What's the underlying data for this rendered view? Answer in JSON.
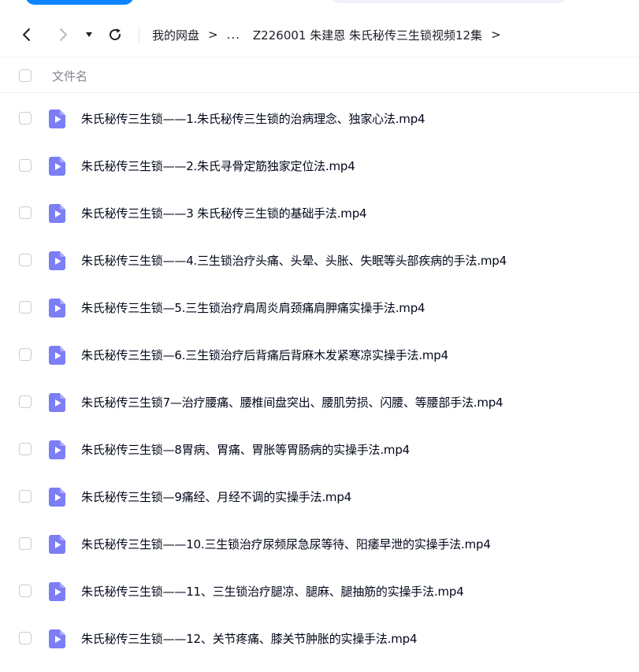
{
  "navigation": {
    "breadcrumb": {
      "root": "我的网盘",
      "separator": ">",
      "ellipsis": "...",
      "current": "Z226001 朱建恩 朱氏秘传三生锁视频12集"
    }
  },
  "table": {
    "header_label": "文件名"
  },
  "files": [
    {
      "name": "朱氏秘传三生锁——1.朱氏秘传三生锁的治病理念、独家心法.mp4"
    },
    {
      "name": "朱氏秘传三生锁——2.朱氏寻骨定筋独家定位法.mp4"
    },
    {
      "name": "朱氏秘传三生锁——3 朱氏秘传三生锁的基础手法.mp4"
    },
    {
      "name": "朱氏秘传三生锁——4.三生锁治疗头痛、头晕、头胀、失眠等头部疾病的手法.mp4"
    },
    {
      "name": "朱氏秘传三生锁—5.三生锁治疗肩周炎肩颈痛肩胛痛实操手法.mp4"
    },
    {
      "name": "朱氏秘传三生锁—6.三生锁治疗后背痛后背麻木发紧寒凉实操手法.mp4"
    },
    {
      "name": "朱氏秘传三生锁7—治疗腰痛、腰椎间盘突出、腰肌劳损、闪腰、等腰部手法.mp4"
    },
    {
      "name": "朱氏秘传三生锁—8胃病、胃痛、胃胀等胃肠病的实操手法.mp4"
    },
    {
      "name": "朱氏秘传三生锁—9痛经、月经不调的实操手法.mp4"
    },
    {
      "name": "朱氏秘传三生锁——10.三生锁治疗尿频尿急尿等待、阳痿早泄的实操手法.mp4"
    },
    {
      "name": "朱氏秘传三生锁——11、三生锁治疗腿凉、腿麻、腿抽筋的实操手法.mp4"
    },
    {
      "name": "朱氏秘传三生锁——12、关节疼痛、膝关节肿胀的实操手法.mp4"
    }
  ],
  "colors": {
    "file_icon": "#7b7ef5",
    "accent": "#0a84ff"
  }
}
